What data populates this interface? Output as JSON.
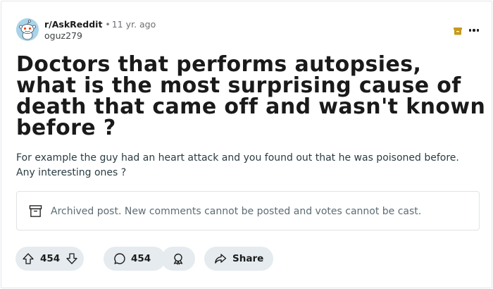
{
  "post": {
    "subreddit": "r/AskReddit",
    "separator": "•",
    "age": "11 yr. ago",
    "author": "oguz279",
    "title": "Doctors that performs autopsies, what is the most surprising cause of death that came off and wasn't known before ?",
    "body": "For example the guy had an heart attack and you found out that he was poisoned before. Any interesting ones ?"
  },
  "notice": {
    "text": "Archived post. New comments cannot be posted and votes cannot be cast."
  },
  "actions": {
    "score": "454",
    "comments": "454",
    "share_label": "Share"
  },
  "colors": {
    "archive_badge": "#c79a1f",
    "pill_bg": "#e5ebee",
    "avatar_bg": "#a9d3ea"
  },
  "icons": {
    "archive": "archive-box-icon",
    "more": "more-dots-icon",
    "upvote": "upvote-arrow-icon",
    "downvote": "downvote-arrow-icon",
    "comment": "comment-bubble-icon",
    "award": "award-icon",
    "share": "share-arrow-icon"
  }
}
